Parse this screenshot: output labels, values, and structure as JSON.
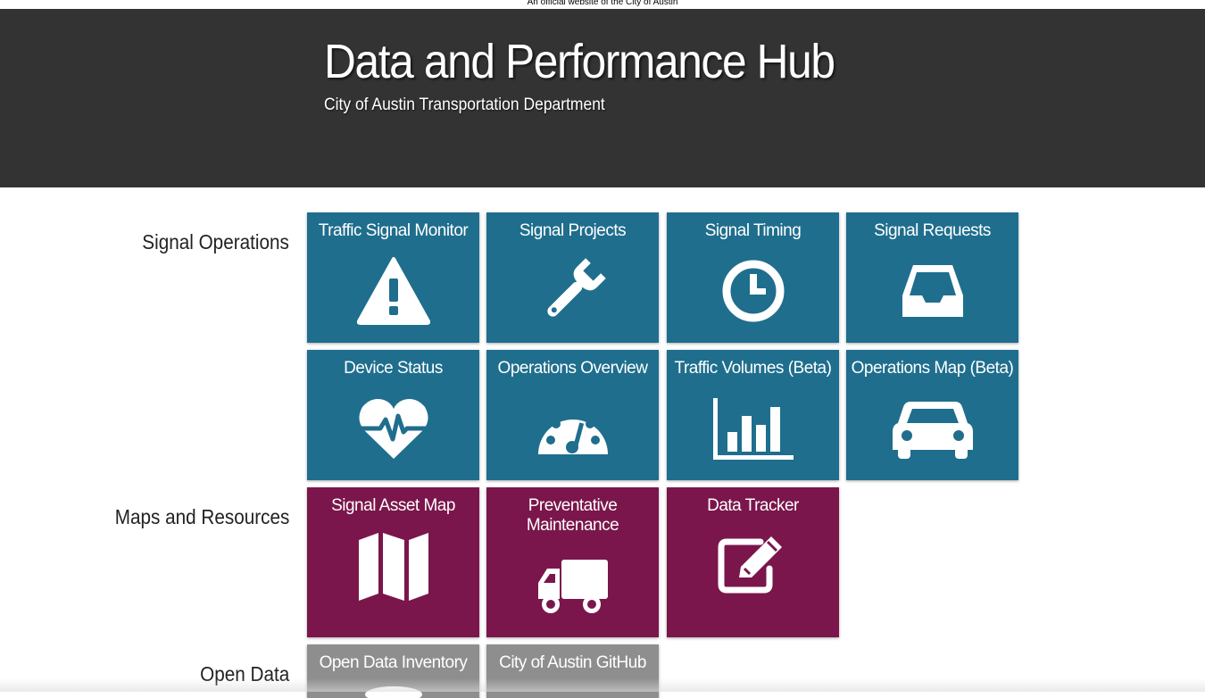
{
  "banner": {
    "text": "An official website of the City of Austin"
  },
  "header": {
    "title": "Data and Performance Hub",
    "subtitle": "City of Austin Transportation Department"
  },
  "colors": {
    "header_bg": "#333333",
    "signal_tile": "#1f6e8d",
    "maps_tile": "#7a164b",
    "open_data_tile": "#8e8e8e"
  },
  "sections": [
    {
      "label": "Signal Operations",
      "tiles": [
        {
          "label": "Traffic Signal Monitor",
          "icon": "warning-icon"
        },
        {
          "label": "Signal Projects",
          "icon": "wrench-icon"
        },
        {
          "label": "Signal Timing",
          "icon": "clock-icon"
        },
        {
          "label": "Signal Requests",
          "icon": "inbox-icon"
        },
        {
          "label": "Device Status",
          "icon": "heartbeat-icon"
        },
        {
          "label": "Operations Overview",
          "icon": "dashboard-icon"
        },
        {
          "label": "Traffic Volumes (Beta)",
          "icon": "bar-chart-icon"
        },
        {
          "label": "Operations Map (Beta)",
          "icon": "car-icon"
        }
      ]
    },
    {
      "label": "Maps and Resources",
      "tiles": [
        {
          "label": "Signal Asset Map",
          "icon": "map-icon"
        },
        {
          "label": "Preventative Maintenance",
          "icon": "truck-icon"
        },
        {
          "label": "Data Tracker",
          "icon": "edit-icon"
        }
      ]
    },
    {
      "label": "Open Data",
      "tiles": [
        {
          "label": "Open Data Inventory",
          "icon": "database-icon"
        },
        {
          "label": "City of Austin GitHub",
          "icon": "github-icon"
        }
      ]
    }
  ]
}
